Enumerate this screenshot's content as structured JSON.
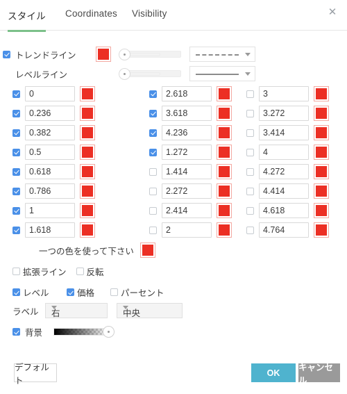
{
  "window": {
    "close_icon": "close-icon"
  },
  "tabs": [
    {
      "label": "スタイル",
      "active": true
    },
    {
      "label": "Coordinates",
      "active": false
    },
    {
      "label": "Visibility",
      "active": false
    }
  ],
  "colors": {
    "accent_green": "#7cc08a",
    "checkbox_blue": "#4a90e8",
    "swatch_red": "#ec2f24",
    "ok_button": "#4fb3ce",
    "cancel_button": "#9a9a9a"
  },
  "line_rows": [
    {
      "label": "トレンドライン",
      "checked": true,
      "has_checkbox": true,
      "color": "#ec2f24",
      "line_style": "dashed"
    },
    {
      "label": "レベルライン",
      "checked": false,
      "has_checkbox": false,
      "color": "#ec2f24",
      "line_style": "solid"
    }
  ],
  "levels": {
    "column1": [
      {
        "value": "0",
        "checked": true,
        "color": "#ec2f24"
      },
      {
        "value": "0.236",
        "checked": true,
        "color": "#ec2f24"
      },
      {
        "value": "0.382",
        "checked": true,
        "color": "#ec2f24"
      },
      {
        "value": "0.5",
        "checked": true,
        "color": "#ec2f24"
      },
      {
        "value": "0.618",
        "checked": true,
        "color": "#ec2f24"
      },
      {
        "value": "0.786",
        "checked": true,
        "color": "#ec2f24"
      },
      {
        "value": "1",
        "checked": true,
        "color": "#ec2f24"
      },
      {
        "value": "1.618",
        "checked": true,
        "color": "#ec2f24"
      }
    ],
    "column2": [
      {
        "value": "2.618",
        "checked": true,
        "color": "#ec2f24"
      },
      {
        "value": "3.618",
        "checked": true,
        "color": "#ec2f24"
      },
      {
        "value": "4.236",
        "checked": true,
        "color": "#ec2f24"
      },
      {
        "value": "1.272",
        "checked": true,
        "color": "#ec2f24"
      },
      {
        "value": "1.414",
        "checked": false,
        "color": "#ec2f24"
      },
      {
        "value": "2.272",
        "checked": false,
        "color": "#ec2f24"
      },
      {
        "value": "2.414",
        "checked": false,
        "color": "#ec2f24"
      },
      {
        "value": "2",
        "checked": false,
        "color": "#ec2f24"
      }
    ],
    "column3": [
      {
        "value": "3",
        "checked": false,
        "color": "#ec2f24"
      },
      {
        "value": "3.272",
        "checked": false,
        "color": "#ec2f24"
      },
      {
        "value": "3.414",
        "checked": false,
        "color": "#ec2f24"
      },
      {
        "value": "4",
        "checked": false,
        "color": "#ec2f24"
      },
      {
        "value": "4.272",
        "checked": false,
        "color": "#ec2f24"
      },
      {
        "value": "4.414",
        "checked": false,
        "color": "#ec2f24"
      },
      {
        "value": "4.618",
        "checked": false,
        "color": "#ec2f24"
      },
      {
        "value": "4.764",
        "checked": false,
        "color": "#ec2f24"
      }
    ]
  },
  "single_color": {
    "label": "一つの色を使って下さい",
    "color": "#ec2f24"
  },
  "extend_row": [
    {
      "label": "拡張ライン",
      "checked": false
    },
    {
      "label": "反転",
      "checked": false
    }
  ],
  "display_row": [
    {
      "label": "レベル",
      "checked": true
    },
    {
      "label": "価格",
      "checked": true
    },
    {
      "label": "パーセント",
      "checked": false
    }
  ],
  "label_row": {
    "label": "ラベル",
    "horizontal": "右",
    "vertical": "中央"
  },
  "background_row": {
    "label": "背景",
    "checked": true,
    "opacity_percent": 100
  },
  "footer": {
    "default_label": "デフォルト",
    "ok_label": "OK",
    "cancel_label": "キャンセル"
  }
}
